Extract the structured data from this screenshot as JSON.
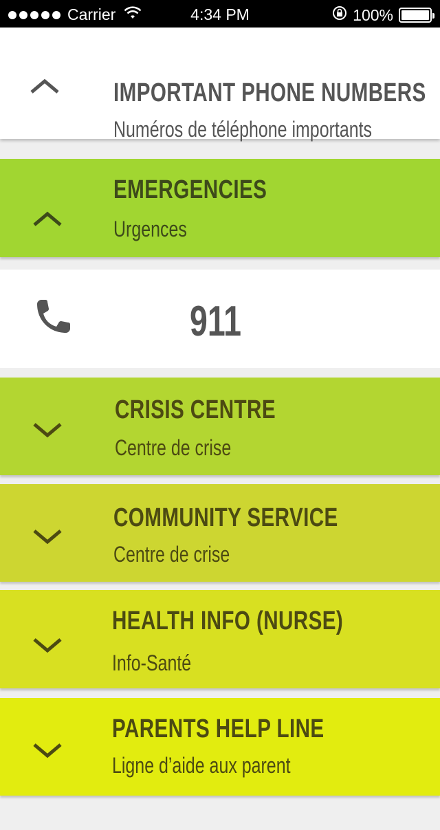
{
  "status_bar": {
    "carrier": "Carrier",
    "time": "4:34 PM",
    "battery": "100%"
  },
  "header": {
    "title": "IMPORTANT PHONE NUMBERS",
    "subtitle": "Numéros de téléphone importants",
    "expanded": true
  },
  "sections": [
    {
      "title": "EMERGENCIES",
      "subtitle": "Urgences",
      "expanded": true,
      "color": "#a1d631",
      "phone": "911"
    },
    {
      "title": "CRISIS CENTRE",
      "subtitle": "Centre de crise",
      "expanded": false,
      "color": "#b3d631"
    },
    {
      "title": "COMMUNITY SERVICE",
      "subtitle": "Centre de crise",
      "expanded": false,
      "color": "#cdd631"
    },
    {
      "title": "HEALTH INFO (NURSE)",
      "subtitle": "Info-Santé",
      "expanded": false,
      "color": "#d8e021"
    },
    {
      "title": "PARENTS HELP LINE",
      "subtitle": "Ligne d’aide aux parent",
      "expanded": false,
      "color": "#e2ec0f"
    }
  ],
  "icons": {
    "expanded": "chevron-up-icon",
    "collapsed": "chevron-down-icon",
    "phone": "phone-icon"
  }
}
